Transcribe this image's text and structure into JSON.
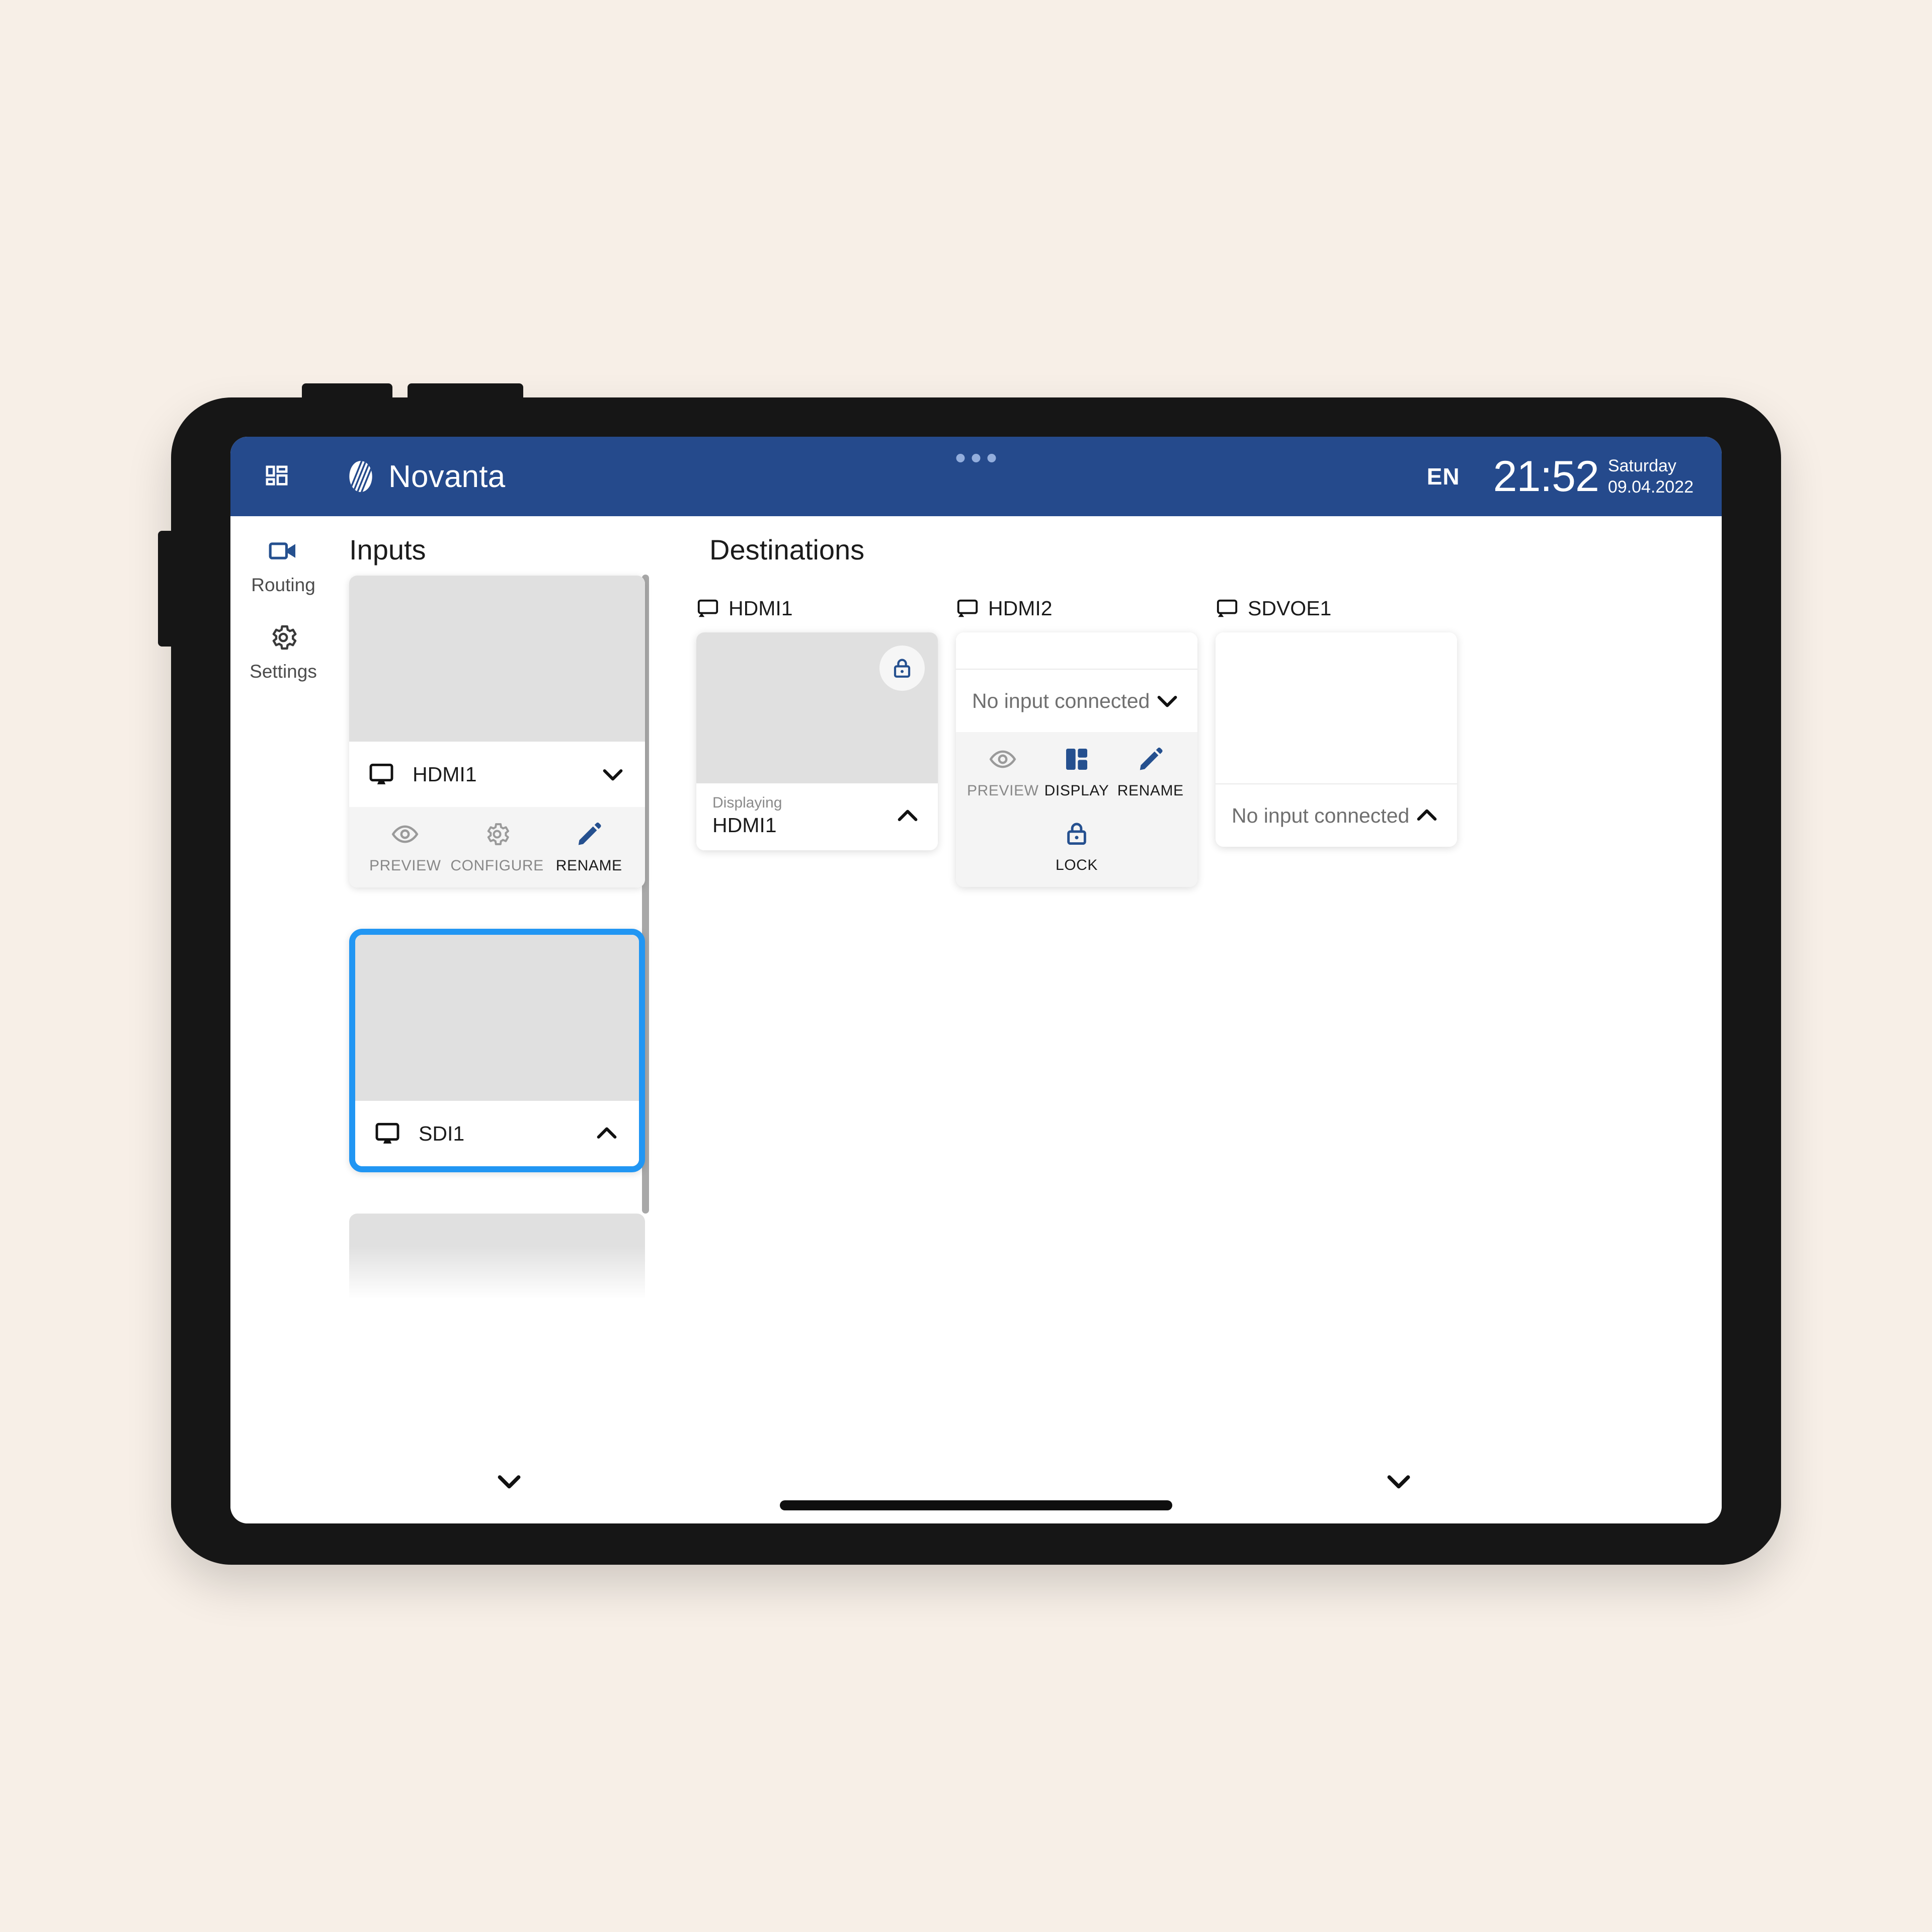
{
  "header": {
    "grid_menu_icon": "grid-menu-icon",
    "brand_name": "Novanta",
    "language": "EN",
    "time": "21:52",
    "weekday": "Saturday",
    "date": "09.04.2022",
    "accent_blue": "#254a8c",
    "drag_dots": 3
  },
  "sidebar": {
    "items": [
      {
        "label": "Routing",
        "icon": "video-camera-icon",
        "active": true
      },
      {
        "label": "Settings",
        "icon": "gear-icon",
        "active": false
      }
    ]
  },
  "inputs": {
    "title": "Inputs",
    "cards": [
      {
        "name": "HDMI1",
        "icon": "monitor-icon",
        "expanded": true,
        "chevron": "chevron-down-icon",
        "selected": false,
        "actions": [
          {
            "label": "PREVIEW",
            "icon": "eye-icon",
            "enabled": false
          },
          {
            "label": "CONFIGURE",
            "icon": "gear-icon",
            "enabled": false
          },
          {
            "label": "RENAME",
            "icon": "pencil-icon",
            "enabled": true
          }
        ]
      },
      {
        "name": "SDI1",
        "icon": "monitor-icon",
        "expanded": false,
        "chevron": "chevron-up-icon",
        "selected": true,
        "actions": []
      }
    ],
    "scroll_down_icon": "chevron-down-icon"
  },
  "destinations": {
    "title": "Destinations",
    "scroll_down_icon": "chevron-down-icon",
    "cards": [
      {
        "name": "HDMI1",
        "icon": "cast-screen-icon",
        "thumb": "gray",
        "locked": true,
        "lock_icon": "lock-icon",
        "footer_kicker": "Displaying",
        "footer_value": "HDMI1",
        "chevron": "chevron-up-icon",
        "expanded": false,
        "actions": []
      },
      {
        "name": "HDMI2",
        "icon": "cast-screen-icon",
        "thumb": "white",
        "locked": false,
        "select_value": "No input connected",
        "chevron": "chevron-down-icon",
        "expanded": true,
        "actions": [
          {
            "label": "PREVIEW",
            "icon": "eye-icon",
            "enabled": false
          },
          {
            "label": "DISPLAY",
            "icon": "layout-icon",
            "enabled": true
          },
          {
            "label": "RENAME",
            "icon": "pencil-icon",
            "enabled": true
          },
          {
            "label": "LOCK",
            "icon": "lock-icon",
            "enabled": true
          }
        ]
      },
      {
        "name": "SDVOE1",
        "icon": "cast-screen-icon",
        "thumb": "white",
        "locked": false,
        "select_value": "No input connected",
        "chevron": "chevron-up-icon",
        "expanded": false,
        "actions": []
      }
    ]
  },
  "colors": {
    "page_background": "#f7efe7",
    "device_bezel": "#161616",
    "header_blue": "#254a8c",
    "selection_blue": "#2196f3",
    "icon_blue": "#25508f",
    "thumb_gray": "#e0e0e0"
  }
}
